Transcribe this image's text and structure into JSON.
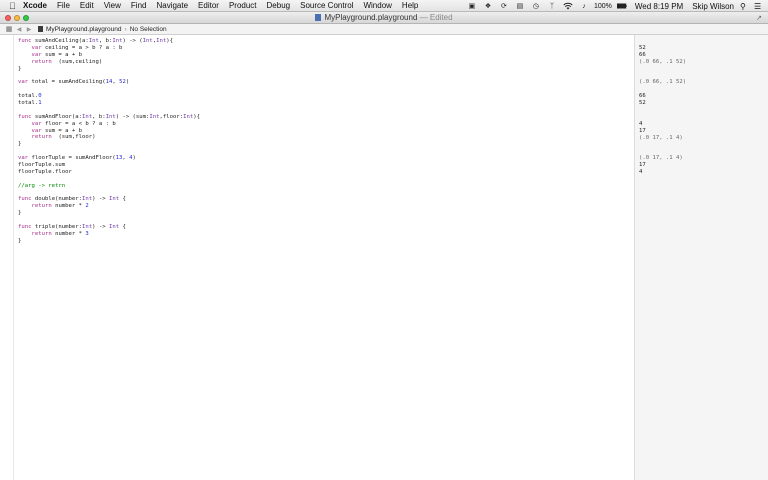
{
  "menubar": {
    "apple_icon": "apple-icon",
    "app_name": "Xcode",
    "items": [
      "File",
      "Edit",
      "View",
      "Find",
      "Navigate",
      "Editor",
      "Product",
      "Debug",
      "Source Control",
      "Window",
      "Help"
    ],
    "battery": "100%",
    "clock": "Wed 8:19 PM",
    "user": "Skip Wilson"
  },
  "window": {
    "title": "MyPlayground.playground",
    "edited": "— Edited"
  },
  "jumpbar": {
    "file": "MyPlayground.playground",
    "selection": "No Selection"
  },
  "code": {
    "lines": [
      "func sumAndCeiling(a:Int, b:Int) -> (Int,Int){",
      "    var ceiling = a > b ? a : b",
      "    var sum = a + b",
      "    return  (sum,ceiling)",
      "}",
      "",
      "var total = sumAndCeiling(14, 52)",
      "",
      "total.0",
      "total.1",
      "",
      "func sumAndFloor(a:Int, b:Int) -> (sum:Int,floor:Int){",
      "    var floor = a < b ? a : b",
      "    var sum = a + b",
      "    return  (sum,floor)",
      "}",
      "",
      "var floorTuple = sumAndFloor(13, 4)",
      "floorTuple.sum",
      "floorTuple.floor",
      "",
      "//arg -> retrn",
      "",
      "func double(number:Int) -> Int {",
      "    return number * 2",
      "}",
      "",
      "func triple(number:Int) -> Int {",
      "    return number * 3",
      "}"
    ]
  },
  "results": [
    {
      "line": 1,
      "text": "52"
    },
    {
      "line": 2,
      "text": "66"
    },
    {
      "line": 3,
      "text": "(.0 66, .1 52)"
    },
    {
      "line": 6,
      "text": "(.0 66, .1 52)"
    },
    {
      "line": 8,
      "text": "66"
    },
    {
      "line": 9,
      "text": "52"
    },
    {
      "line": 12,
      "text": "4"
    },
    {
      "line": 13,
      "text": "17"
    },
    {
      "line": 14,
      "text": "(.0 17, .1 4)"
    },
    {
      "line": 17,
      "text": "(.0 17, .1 4)"
    },
    {
      "line": 18,
      "text": "17"
    },
    {
      "line": 19,
      "text": "4"
    }
  ]
}
